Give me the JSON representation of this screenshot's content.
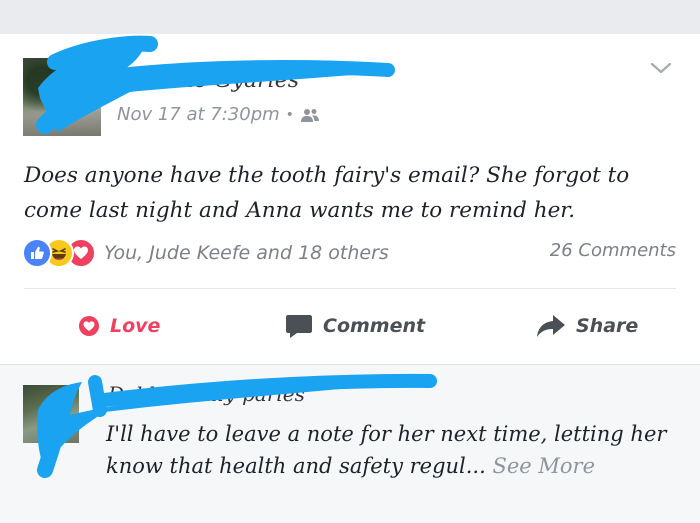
{
  "post": {
    "author_name": "Danielle Gyarles",
    "timestamp": "Nov 17 at 7:30pm",
    "separator": "•",
    "audience_icon": "friends-icon",
    "options_icon": "chevron-down-icon",
    "text": "Does anyone have the tooth fairy's email? She forgot to come last night and Anna wants me to remind her.",
    "reactions": {
      "icons": [
        "like-reaction-icon",
        "haha-reaction-icon",
        "love-reaction-icon"
      ],
      "summary": "You, Jude Keefe and 18 others",
      "comments_count": "26 Comments"
    },
    "actions": {
      "love_label": "Love",
      "comment_label": "Comment",
      "share_label": "Share"
    }
  },
  "comment": {
    "author_name": "Debbie Lally-parles",
    "text": "I'll have to leave a note for her next time, letting her know that health and safety regul...",
    "see_more_label": "See More"
  },
  "colors": {
    "love": "#f0405f",
    "like": "#4a83f6",
    "haha": "#f7c91c",
    "scribble": "#1aa3f0",
    "meta_gray": "#90949c",
    "page_gray": "#e9ebee"
  }
}
